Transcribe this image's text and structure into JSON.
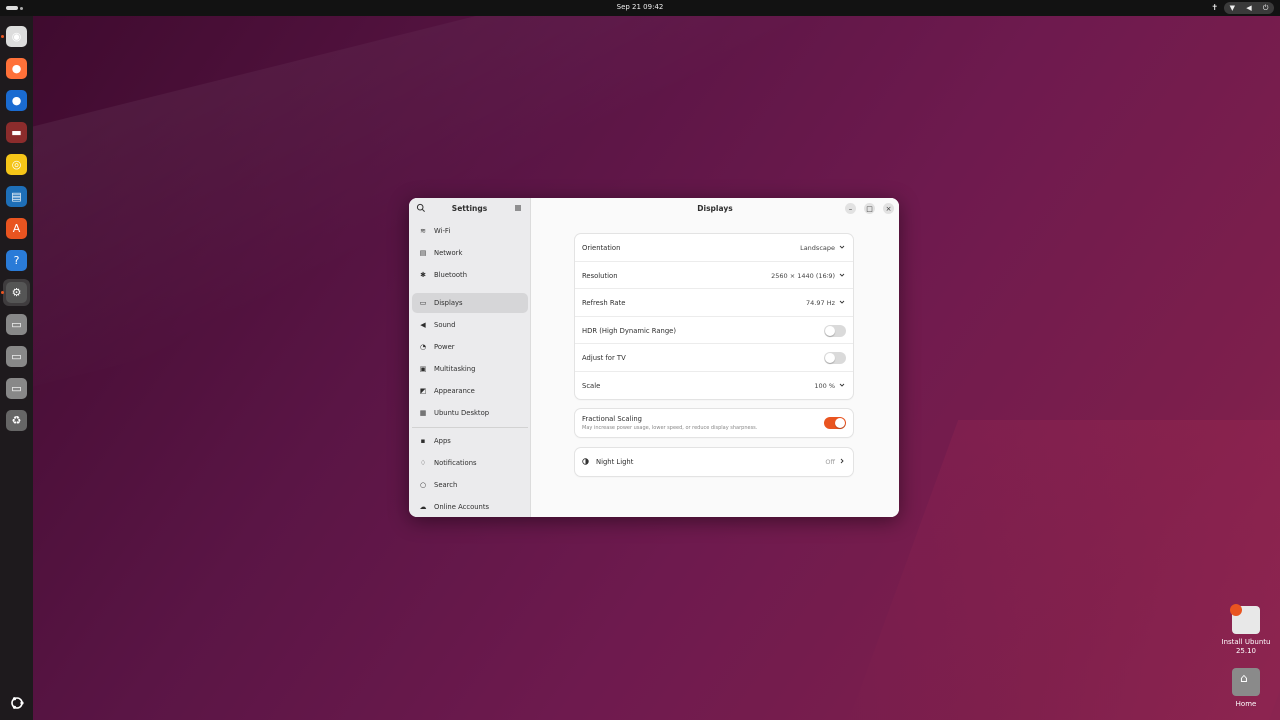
{
  "topbar": {
    "clock": "Sep 21  09:42"
  },
  "dock": {
    "items": [
      {
        "name": "installer-icon",
        "glyph": "◉"
      },
      {
        "name": "firefox-icon",
        "glyph": "●"
      },
      {
        "name": "thunderbird-icon",
        "glyph": "●"
      },
      {
        "name": "files-icon",
        "glyph": "▬"
      },
      {
        "name": "rhythmbox-icon",
        "glyph": "◎"
      },
      {
        "name": "writer-icon",
        "glyph": "▤"
      },
      {
        "name": "app-center-icon",
        "glyph": "A"
      },
      {
        "name": "help-icon",
        "glyph": "?"
      },
      {
        "name": "settings-icon",
        "glyph": "⚙"
      },
      {
        "name": "drive-icon",
        "glyph": "▭"
      },
      {
        "name": "drive-icon",
        "glyph": "▭"
      },
      {
        "name": "drive-icon",
        "glyph": "▭"
      },
      {
        "name": "trash-icon",
        "glyph": "♻"
      }
    ]
  },
  "settings": {
    "sidebar_title": "Settings",
    "nav": [
      {
        "label": "Wi-Fi",
        "icon": "wifi-icon"
      },
      {
        "label": "Network",
        "icon": "network-icon"
      },
      {
        "label": "Bluetooth",
        "icon": "bluetooth-icon"
      },
      {
        "label": "Displays",
        "icon": "display-icon"
      },
      {
        "label": "Sound",
        "icon": "sound-icon"
      },
      {
        "label": "Power",
        "icon": "power-icon"
      },
      {
        "label": "Multitasking",
        "icon": "multitasking-icon"
      },
      {
        "label": "Appearance",
        "icon": "appearance-icon"
      },
      {
        "label": "Ubuntu Desktop",
        "icon": "ubuntu-desktop-icon"
      },
      {
        "label": "Apps",
        "icon": "apps-icon"
      },
      {
        "label": "Notifications",
        "icon": "bell-icon"
      },
      {
        "label": "Search",
        "icon": "search-icon"
      },
      {
        "label": "Online Accounts",
        "icon": "cloud-icon"
      }
    ],
    "selected": "Displays"
  },
  "displays": {
    "title": "Displays",
    "orientation": {
      "label": "Orientation",
      "value": "Landscape"
    },
    "resolution": {
      "label": "Resolution",
      "value": "2560 × 1440 (16∶9)"
    },
    "refresh_rate": {
      "label": "Refresh Rate",
      "value": "74.97 Hz"
    },
    "hdr": {
      "label": "HDR (High Dynamic Range)",
      "on": false
    },
    "adjust_tv": {
      "label": "Adjust for TV",
      "on": false
    },
    "scale": {
      "label": "Scale",
      "value": "100 %"
    },
    "fractional": {
      "label": "Fractional Scaling",
      "description": "May increase power usage, lower speed, or reduce display sharpness.",
      "on": true
    },
    "night_light": {
      "label": "Night Light",
      "value": "Off"
    }
  },
  "desktop": {
    "install_label_1": "Install Ubuntu",
    "install_label_2": "25.10",
    "home_label": "Home"
  },
  "colors": {
    "accent": "#e95420"
  }
}
